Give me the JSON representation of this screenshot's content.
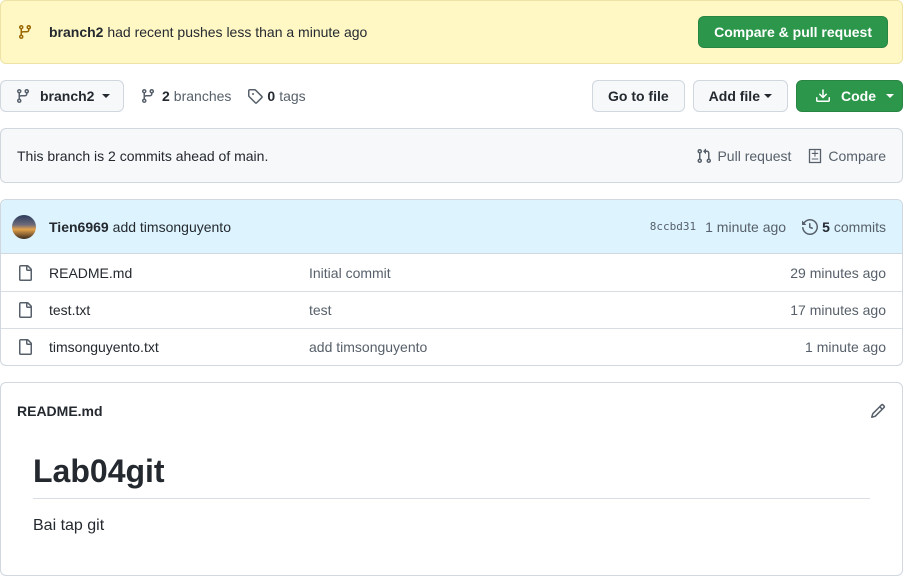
{
  "flash": {
    "branch": "branch2",
    "message": " had recent pushes less than a minute ago",
    "button": "Compare & pull request"
  },
  "toolbar": {
    "branch_button": "branch2",
    "branches_count": "2",
    "branches_label": "branches",
    "tags_count": "0",
    "tags_label": "tags",
    "go_to_file": "Go to file",
    "add_file": "Add file",
    "code": "Code"
  },
  "ahead": {
    "text": "This branch is 2 commits ahead of main.",
    "pull_request": "Pull request",
    "compare": "Compare"
  },
  "latest_commit": {
    "author": "Tien6969",
    "message": "add timsonguyento",
    "sha": "8ccbd31",
    "time": "1 minute ago",
    "commits_count": "5",
    "commits_label": "commits"
  },
  "files": [
    {
      "name": "README.md",
      "message": "Initial commit",
      "age": "29 minutes ago"
    },
    {
      "name": "test.txt",
      "message": "test",
      "age": "17 minutes ago"
    },
    {
      "name": "timsonguyento.txt",
      "message": "add timsonguyento",
      "age": "1 minute ago"
    }
  ],
  "readme": {
    "title": "README.md",
    "heading": "Lab04git",
    "body": "Bai tap git"
  },
  "colors": {
    "flash_bg": "#fff8c5",
    "green_button": "#2c974b",
    "commit_bar_bg": "#ddf4ff",
    "branch_icon": "#9a6700"
  },
  "icons": [
    "git-branch-icon",
    "tag-icon",
    "download-icon",
    "pull-request-icon",
    "compare-icon",
    "history-icon",
    "file-icon",
    "pencil-icon"
  ]
}
